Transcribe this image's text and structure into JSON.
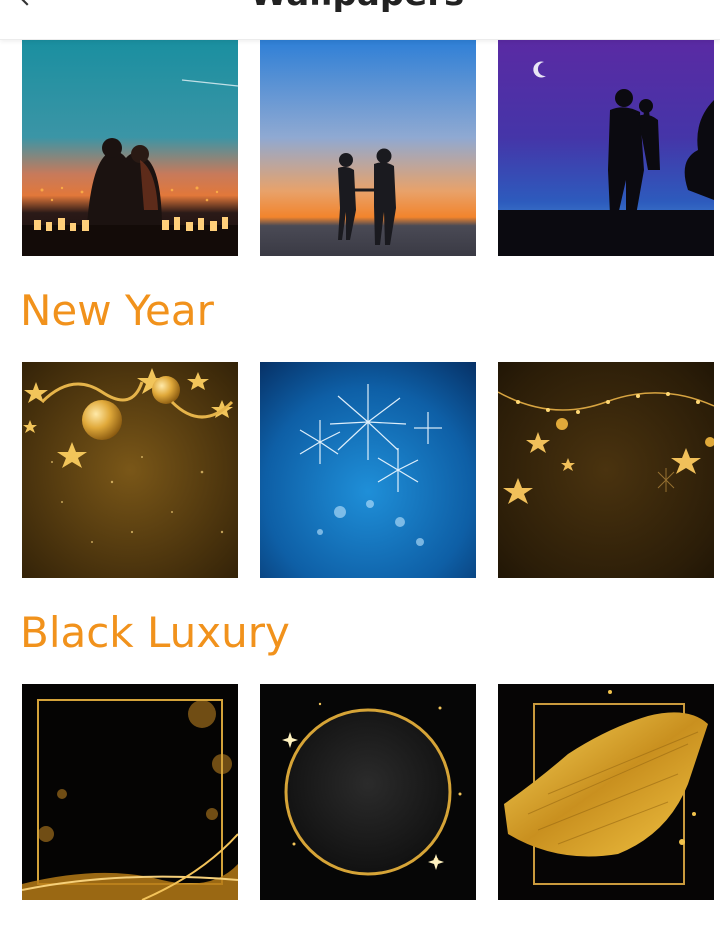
{
  "topbar": {
    "title": "Wallpapers",
    "back_icon": "back-arrow-icon"
  },
  "sections": [
    {
      "heading": "",
      "items": [
        {
          "name": "couple-sunset-city-lights"
        },
        {
          "name": "couple-holding-hands-dusk"
        },
        {
          "name": "couple-silhouette-purple-night"
        }
      ]
    },
    {
      "heading": "New Year",
      "items": [
        {
          "name": "gold-ornaments-stars"
        },
        {
          "name": "blue-fireworks"
        },
        {
          "name": "gold-string-lights-stars"
        }
      ]
    },
    {
      "heading": "Black Luxury",
      "items": [
        {
          "name": "black-gold-square-frame"
        },
        {
          "name": "black-gold-circle-frame"
        },
        {
          "name": "gold-brush-stroke-frame"
        }
      ]
    }
  ],
  "colors": {
    "heading": "#f1921c",
    "background": "#ffffff"
  }
}
